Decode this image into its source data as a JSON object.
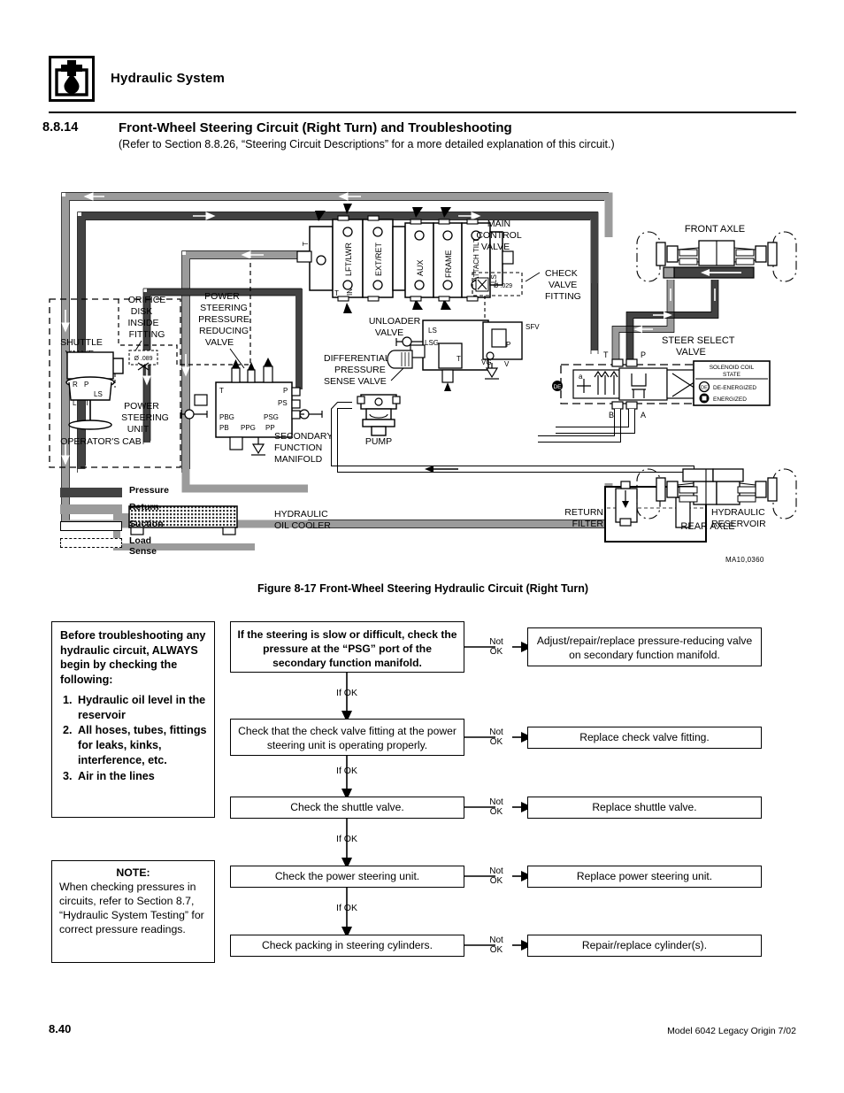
{
  "header": {
    "title": "Hydraulic System",
    "icon": "hydraulic-fluid-icon"
  },
  "section": {
    "number": "8.8.14",
    "title": "Front-Wheel Steering Circuit (Right Turn) and Troubleshooting",
    "subtitle": "(Refer to Section 8.8.26, “Steering Circuit Descriptions” for a more detailed explanation of this circuit.)"
  },
  "figure": {
    "code": "MA10,0360",
    "caption": "Figure 8-17  Front-Wheel Steering Hydraulic Circuit (Right Turn)",
    "legend": [
      {
        "label": "Pressure",
        "color": "#424242",
        "style": "solid-fill"
      },
      {
        "label": "Return",
        "color": "#9b9b9b",
        "style": "solid-fill"
      },
      {
        "label": "Suction",
        "color": "#ffffff",
        "style": "outline"
      },
      {
        "label": "Load Sense",
        "color": "#ffffff",
        "style": "dashed"
      }
    ],
    "callouts": {
      "main_control_valve": "MAIN\nCONTROL\nVALVE",
      "main_control_valve_l1": "MAIN",
      "main_control_valve_l2": "CONTROL",
      "main_control_valve_l3": "VALVE",
      "mcv_sections": [
        "LFT/LWR",
        "EXT/RET",
        "AUX",
        "FRAME",
        "ATTACH TILT"
      ],
      "mcv_ports": [
        "T",
        "T",
        "IN",
        "LS"
      ],
      "check_valve_fitting_l1": "CHECK",
      "check_valve_fitting_l2": "VALVE",
      "check_valve_fitting_l3": "FITTING",
      "check_valve_orifice": "Ø .029",
      "orifice_disk_l1": "ORIFICE",
      "orifice_disk_l2": "DISK",
      "orifice_disk_l3": "INSIDE",
      "orifice_disk_l4": "FITTING",
      "orifice_disk_size": "Ø .089",
      "shuttle_valve_l1": "SHUTTLE",
      "shuttle_valve_l2": "VALVE",
      "psprv_l1": "POWER",
      "psprv_l2": "STEERING",
      "psprv_l3": "PRESSURE",
      "psprv_l4": "REDUCING",
      "psprv_l5": "VALVE",
      "power_steering_unit_l1": "POWER",
      "power_steering_unit_l2": "STEERING",
      "power_steering_unit_l3": "UNIT",
      "psu_ports": [
        "R",
        "P",
        "LS",
        "L",
        "T"
      ],
      "operators_cab": "OPERATOR'S  CAB",
      "unloader_valve_l1": "UNLOADER",
      "unloader_valve_l2": "VALVE",
      "unloader_ports": [
        "LS",
        "LSG",
        "SFV",
        "P",
        "T",
        "VG",
        "V"
      ],
      "diff_press_sense_l1": "DIFFERENTIAL",
      "diff_press_sense_l2": "PRESSURE",
      "diff_press_sense_l3": "SENSE VALVE",
      "secondary_manifold_l1": "SECONDARY",
      "secondary_manifold_l2": "FUNCTION",
      "secondary_manifold_l3": "MANIFOLD",
      "sfm_ports": [
        "T",
        "P",
        "PS",
        "PBG",
        "PSG",
        "PB",
        "PPG",
        "PP"
      ],
      "pump": "PUMP",
      "hydraulic_oil_cooler_l1": "HYDRAULIC",
      "hydraulic_oil_cooler_l2": "OIL  COOLER",
      "return_filter_l1": "RETURN",
      "return_filter_l2": "FILTER",
      "hydraulic_reservoir_l1": "HYDRAULIC",
      "hydraulic_reservoir_l2": "RESERVOIR",
      "front_axle": "FRONT  AXLE",
      "rear_axle": "REAR  AXLE",
      "steer_select_valve_l1": "STEER SELECT",
      "steer_select_valve_l2": "VALVE",
      "ssv_ports": [
        "T",
        "P",
        "B",
        "A",
        "a",
        "b"
      ],
      "solenoid_legend_title_l1": "SOLENOID COIL",
      "solenoid_legend_title_l2": "STATE",
      "solenoid_deenergized": "DE-ENERGIZED",
      "solenoid_energized": "ENERGIZED"
    }
  },
  "troubleshooting": {
    "info": {
      "heading": "Before troubleshooting any hydraulic circuit, ALWAYS begin by checking the following:",
      "items": [
        "Hydraulic oil level in the reservoir",
        "All hoses, tubes, fittings for leaks, kinks, interference, etc.",
        "Air in the lines"
      ]
    },
    "note": {
      "title": "NOTE:",
      "body": "When checking pressures in circuits, refer to Section 8.7, “Hydraulic System Testing” for correct pressure readings."
    },
    "labels": {
      "not_ok": "Not\nOK",
      "not_ok_l1": "Not",
      "not_ok_l2": "OK",
      "if_ok": "If OK"
    },
    "steps": [
      {
        "check": "If the steering is slow or difficult, check the pressure at the “PSG” port of the secondary function manifold.",
        "action": "Adjust/repair/replace pressure-reducing valve on secondary function manifold."
      },
      {
        "check": "Check that the check valve fitting at the power steering unit is operating properly.",
        "action": "Replace check valve fitting."
      },
      {
        "check": "Check the shuttle valve.",
        "action": "Replace shuttle valve."
      },
      {
        "check": "Check the power steering unit.",
        "action": "Replace power steering unit."
      },
      {
        "check": "Check packing in steering cylinders.",
        "action": "Repair/replace cylinder(s)."
      }
    ]
  },
  "footer": {
    "page": "8.40",
    "model": "Model  6042  Legacy    Origin  7/02"
  }
}
